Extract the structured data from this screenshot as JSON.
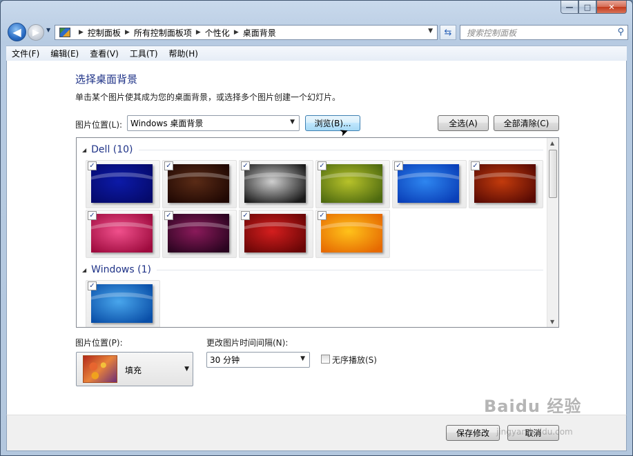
{
  "window": {
    "caption": {
      "minimize": "—",
      "maximize": "□",
      "close": "✕"
    }
  },
  "nav": {
    "back_icon": "◀",
    "forward_icon": "▶",
    "breadcrumbs": [
      "控制面板",
      "所有控制面板项",
      "个性化",
      "桌面背景"
    ],
    "search_placeholder": "搜索控制面板"
  },
  "menu": [
    "文件(F)",
    "编辑(E)",
    "查看(V)",
    "工具(T)",
    "帮助(H)"
  ],
  "main": {
    "title": "选择桌面背景",
    "subtitle": "单击某个图片使其成为您的桌面背景，或选择多个图片创建一个幻灯片。",
    "picture_location_label": "图片位置(L):",
    "picture_location_value": "Windows 桌面背景",
    "browse_label": "浏览(B)...",
    "select_all_label": "全选(A)",
    "clear_all_label": "全部清除(C)"
  },
  "groups": [
    {
      "name": "Dell (10)",
      "tiles": [
        {
          "checked": true,
          "colors": [
            "#0c1aa8",
            "#050a6c"
          ]
        },
        {
          "checked": true,
          "colors": [
            "#5a2b16",
            "#200803"
          ]
        },
        {
          "checked": true,
          "colors": [
            "#cfcfcf",
            "#1a1a1a"
          ]
        },
        {
          "checked": true,
          "colors": [
            "#b7c22a",
            "#4e6a10"
          ]
        },
        {
          "checked": true,
          "colors": [
            "#2e86f0",
            "#0a3fb8"
          ]
        },
        {
          "checked": true,
          "colors": [
            "#c33b0c",
            "#5a0b04"
          ]
        },
        {
          "checked": true,
          "colors": [
            "#f0508c",
            "#9e0b3e"
          ]
        },
        {
          "checked": true,
          "colors": [
            "#8a1a5a",
            "#2a0420"
          ]
        },
        {
          "checked": true,
          "colors": [
            "#d41e1e",
            "#6a0606"
          ]
        },
        {
          "checked": true,
          "colors": [
            "#ffc21a",
            "#e66a02"
          ]
        }
      ]
    },
    {
      "name": "Windows (1)",
      "tiles": [
        {
          "checked": true,
          "colors": [
            "#49a6ec",
            "#0a4fa8"
          ]
        }
      ]
    }
  ],
  "bottom": {
    "position_label": "图片位置(P):",
    "position_value": "填充",
    "interval_label": "更改图片时间间隔(N):",
    "interval_value": "30 分钟",
    "shuffle_label": "无序播放(S)"
  },
  "footer": {
    "save_label": "保存修改",
    "cancel_label": "取消"
  },
  "watermark": {
    "main": "Baidu 经验",
    "sub": "jingyan.baidu.com"
  },
  "icons": [
    "back-arrow-icon",
    "forward-arrow-icon",
    "control-panel-icon",
    "refresh-icon",
    "search-icon",
    "cursor-icon"
  ]
}
